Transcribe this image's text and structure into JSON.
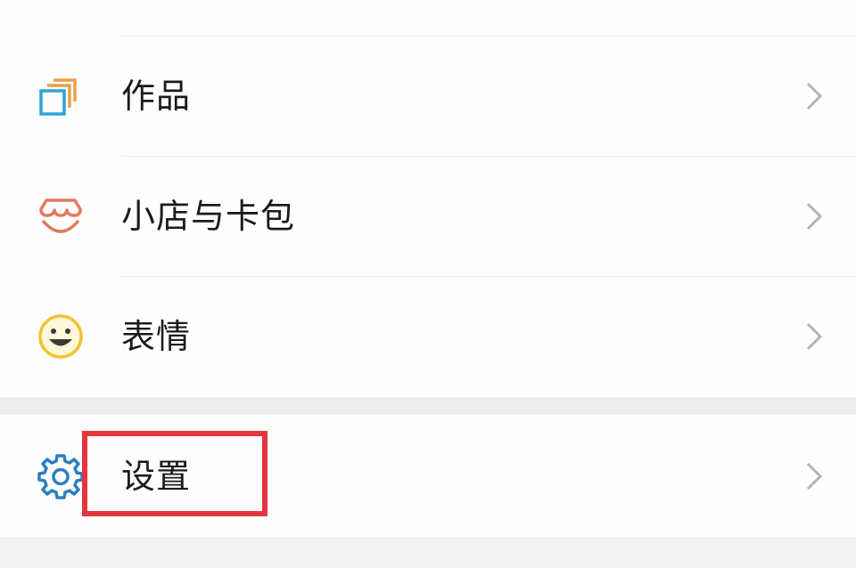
{
  "menu": {
    "items": [
      {
        "label": "作品",
        "icon": "works-icon"
      },
      {
        "label": "小店与卡包",
        "icon": "shop-icon"
      },
      {
        "label": "表情",
        "icon": "smiley-icon"
      }
    ],
    "settings": {
      "label": "设置",
      "icon": "gear-icon"
    }
  },
  "colors": {
    "highlight": "#e3363d",
    "works_icon": "#2fa0d8",
    "works_icon_accent": "#e8a048",
    "shop_icon": "#e07a5f",
    "smiley_icon": "#f2c230",
    "gear_icon": "#2a7fc1",
    "chevron": "#b3b3b3"
  }
}
